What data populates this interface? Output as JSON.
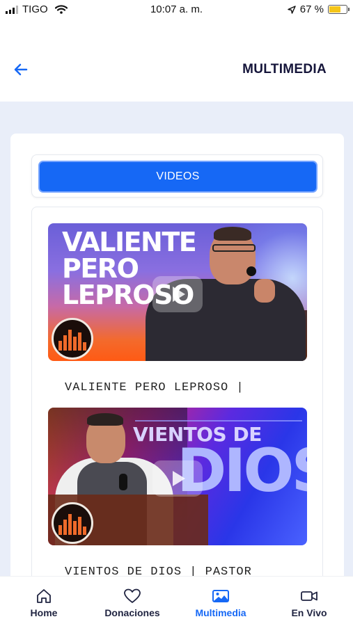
{
  "status_bar": {
    "carrier": "TIGO",
    "time": "10:07 a. m.",
    "battery_percent": "67 %",
    "battery_level": 0.67
  },
  "header": {
    "title": "MULTIMEDIA",
    "back_icon": "arrow-left-icon"
  },
  "tabs": [
    {
      "label": "VIDEOS",
      "active": true
    }
  ],
  "videos": [
    {
      "title": "VALIENTE PERO LEPROSO |",
      "thumbnail_text": [
        "VALIENTE",
        "PERO",
        "LEPROSO"
      ]
    },
    {
      "title": "VIENTOS DE DIOS | PASTOR",
      "thumbnail_text": [
        "VIENTOS DE",
        "DIOS"
      ]
    }
  ],
  "bottom_nav": [
    {
      "label": "Home",
      "icon": "home-icon",
      "active": false
    },
    {
      "label": "Donaciones",
      "icon": "heart-icon",
      "active": false
    },
    {
      "label": "Multimedia",
      "icon": "image-icon",
      "active": true
    },
    {
      "label": "En Vivo",
      "icon": "video-camera-icon",
      "active": false
    }
  ],
  "colors": {
    "accent": "#1668f5",
    "title": "#15153a",
    "page_bg": "#e9eef9"
  }
}
